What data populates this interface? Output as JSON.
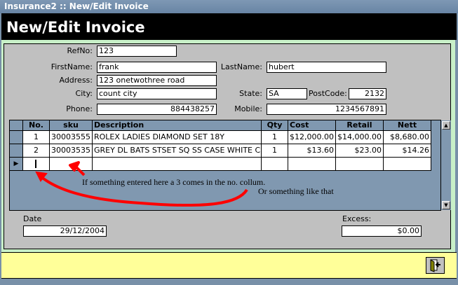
{
  "window": {
    "title": "Insurance2 :: New/Edit Invoice"
  },
  "header": {
    "title": "New/Edit Invoice"
  },
  "form": {
    "refno": {
      "label": "RefNo:",
      "value": "123"
    },
    "firstname": {
      "label": "FirstName:",
      "value": "frank"
    },
    "lastname": {
      "label": "LastName:",
      "value": "hubert"
    },
    "address": {
      "label": "Address:",
      "value": "123 onetwothree road"
    },
    "city": {
      "label": "City:",
      "value": "count city"
    },
    "state": {
      "label": "State:",
      "value": "SA"
    },
    "postcode": {
      "label": "PostCode:",
      "value": "2132"
    },
    "phone": {
      "label": "Phone:",
      "value": "884438257"
    },
    "mobile": {
      "label": "Mobile:",
      "value": "1234567891"
    },
    "date": {
      "label": "Date",
      "value": "29/12/2004"
    },
    "excess": {
      "label": "Excess:",
      "value": "$0.00"
    }
  },
  "grid": {
    "columns": [
      "No.",
      "sku",
      "Description",
      "Qty",
      "Cost",
      "Retail",
      "Nett"
    ],
    "rows": [
      [
        "1",
        "30003555",
        "ROLEX LADIES DIAMOND SET 18Y",
        "1",
        "$12,000.00",
        "$14,000.00",
        "$8,680.00"
      ],
      [
        "2",
        "30003535",
        "GREY DL BATS STSET SQ SS CASE WHITE CU",
        "1",
        "$13.60",
        "$23.00",
        "$14.26"
      ]
    ]
  },
  "annotations": {
    "note1": "If something entered here a 3 comes in the no. collum.",
    "note2": "Or something like that",
    "color": "#ff0000"
  }
}
